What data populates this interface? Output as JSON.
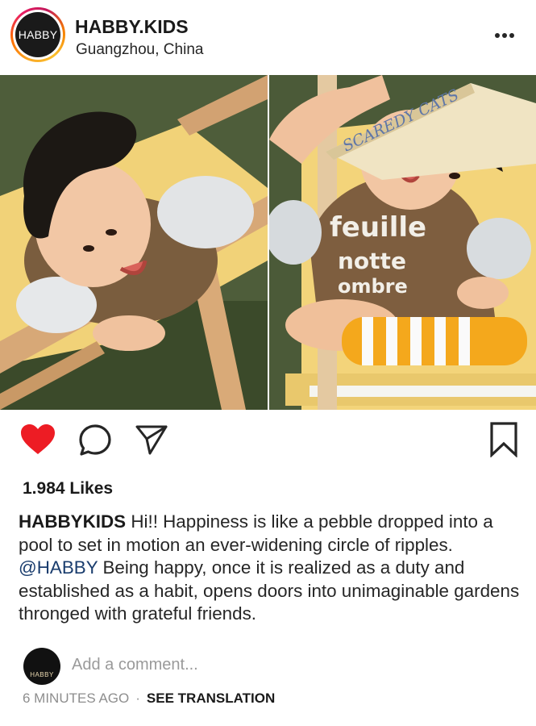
{
  "header": {
    "avatar_text": "HABBY",
    "username": "HABBY.KIDS",
    "location": "Guangzhou, China",
    "more_icon": "more-horizontal-icon"
  },
  "photos": {
    "left_alt": "child-on-wooden-deck-chair",
    "right_alt": "child-with-book-on-head",
    "book_text": "SCAREDY CATS",
    "shirt_text": "feuille notte ombre"
  },
  "actions": {
    "like_icon": "heart-icon",
    "comment_icon": "comment-icon",
    "share_icon": "send-icon",
    "save_icon": "bookmark-icon",
    "like_color": "#ed1c24"
  },
  "post": {
    "likes": "1.984 Likes",
    "caption_user": "HABBYKIDS",
    "caption_part1": " Hi!! Happiness is like a pebble dropped into a pool to set in motion an ever-widening circle of ripples. ",
    "caption_mention": "@HABBY",
    "caption_part2": " Being happy, once it is realized as a duty and established as a habit, opens doors into unimaginable gardens thronged with grateful friends."
  },
  "comment": {
    "avatar_text": "HABBY",
    "placeholder": "Add a comment..."
  },
  "footer": {
    "time": "6 MINUTES AGO",
    "separator": "·",
    "translate": "SEE TRANSLATION"
  }
}
